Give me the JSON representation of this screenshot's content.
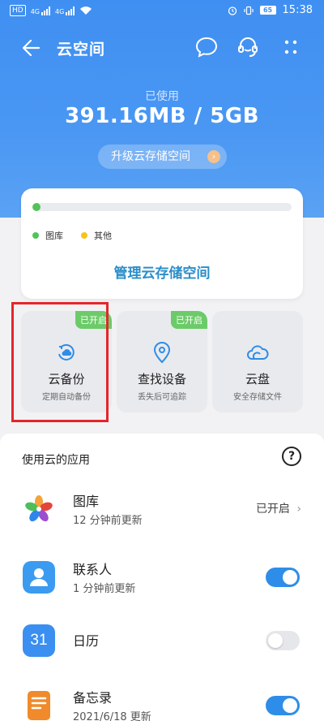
{
  "status_bar": {
    "sim1": "HD",
    "net1": "4G",
    "net2": "4G",
    "battery": "65",
    "time": "15:38"
  },
  "header": {
    "title": "云空间"
  },
  "summary": {
    "used_label": "已使用",
    "used_value": "391.16MB / 5GB",
    "upgrade_label": "升级云存储空间",
    "usage_fraction": 0.03
  },
  "storage_card": {
    "legend": [
      {
        "label": "图库",
        "color": "#52c35a"
      },
      {
        "label": "其他",
        "color": "#f5c518"
      }
    ],
    "manage_label": "管理云存储空间"
  },
  "features": [
    {
      "name": "云备份",
      "sub": "定期自动备份",
      "badge": "已开启",
      "icon": "cloud-backup-icon"
    },
    {
      "name": "查找设备",
      "sub": "丢失后可追踪",
      "badge": "已开启",
      "icon": "location-pin-icon"
    },
    {
      "name": "云盘",
      "sub": "安全存储文件",
      "badge": "",
      "icon": "cloud-icon"
    }
  ],
  "apps_section": {
    "title": "使用云的应用",
    "items": [
      {
        "name": "图库",
        "updated": "12 分钟前更新",
        "status": "已开启",
        "icon": "gallery-icon"
      },
      {
        "name": "联系人",
        "updated": "1 分钟前更新",
        "toggle": "on",
        "icon": "contacts-icon"
      },
      {
        "name": "日历",
        "updated": "",
        "toggle": "off",
        "icon": "calendar-icon",
        "icon_text": "31"
      },
      {
        "name": "备忘录",
        "updated": "2021/6/18 更新",
        "toggle": "on",
        "icon": "notes-icon"
      }
    ]
  },
  "colors": {
    "primary": "#3f8ff2",
    "accent_blue": "#2e8de8",
    "badge_green": "#6ccb69",
    "highlight_red": "#e4262a"
  }
}
